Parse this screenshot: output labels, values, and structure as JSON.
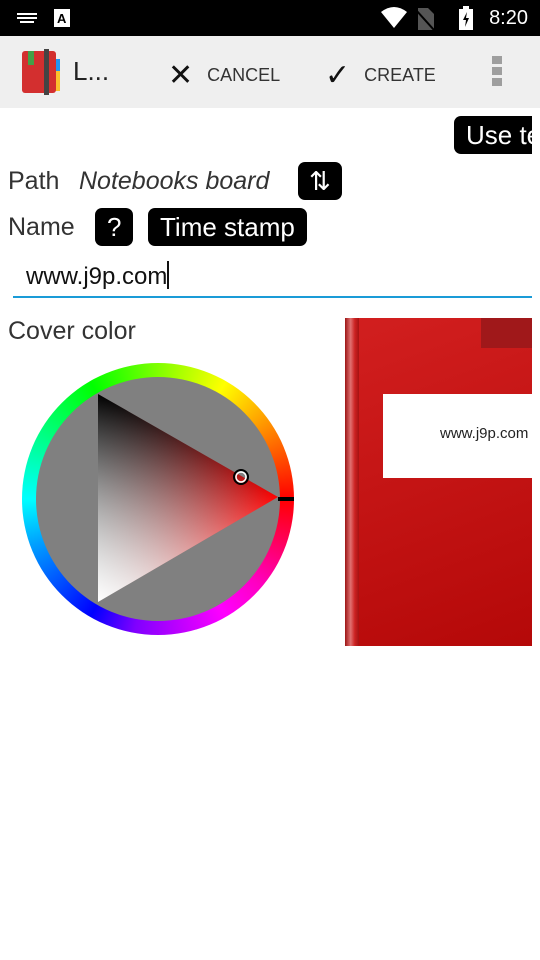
{
  "status": {
    "time": "8:20",
    "icons": [
      "keyboard-icon",
      "text-a-icon",
      "wifi-icon",
      "no-sim-icon",
      "battery-charging-icon"
    ]
  },
  "toolbar": {
    "title": "L...",
    "cancel_label": "CANCEL",
    "create_label": "CREATE"
  },
  "form": {
    "use_button": "Use te",
    "path_label": "Path",
    "path_value": "Notebooks board",
    "swap_icon": "⇅",
    "name_label": "Name",
    "help_button": "?",
    "timestamp_button": "Time stamp",
    "name_value": "www.j9p.com",
    "cover_color_label": "Cover color"
  },
  "cover": {
    "color": "#c81414",
    "label": "www.j9p.com"
  }
}
